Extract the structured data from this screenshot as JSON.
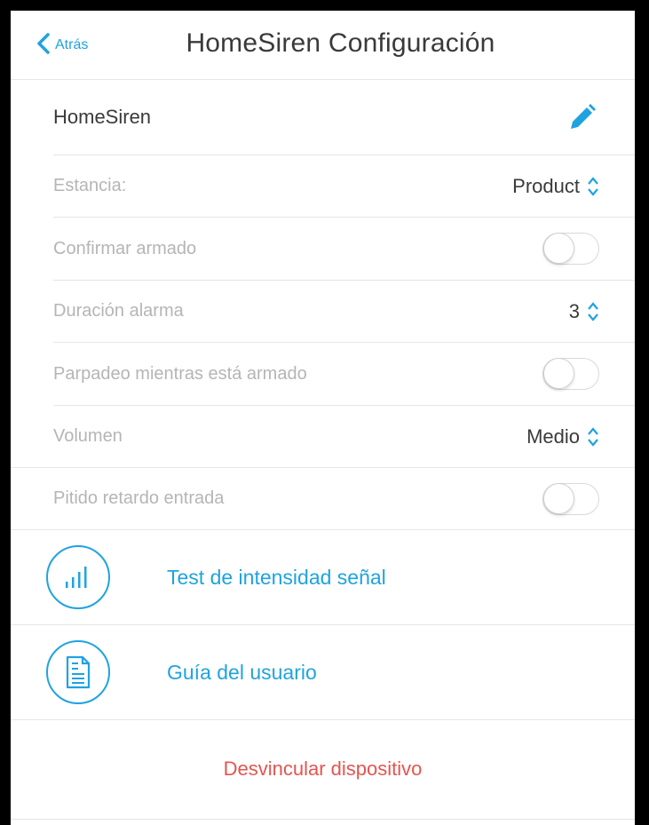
{
  "header": {
    "back_label": "Atrás",
    "title": "HomeSiren Configuración"
  },
  "device": {
    "name": "HomeSiren",
    "edit_icon": "pencil-icon"
  },
  "settings": {
    "room": {
      "label": "Estancia:",
      "value": "Product"
    },
    "confirm_arm": {
      "label": "Confirmar armado",
      "on": false
    },
    "alarm_duration": {
      "label": "Duración alarma",
      "value": "3"
    },
    "blink_armed": {
      "label": "Parpadeo mientras está armado",
      "on": false
    },
    "volume": {
      "label": "Volumen",
      "value": "Medio"
    },
    "entry_delay_beep": {
      "label": "Pitido retardo entrada",
      "on": false
    }
  },
  "actions": {
    "signal_test": {
      "label": "Test de intensidad señal",
      "icon": "signal-bars-icon"
    },
    "user_guide": {
      "label": "Guía del usuario",
      "icon": "document-icon"
    }
  },
  "unlink_label": "Desvincular dispositivo",
  "colors": {
    "accent": "#1fa3e0",
    "danger": "#e4554f",
    "muted_text": "#b5b5b5",
    "text": "#3a3a3a"
  }
}
